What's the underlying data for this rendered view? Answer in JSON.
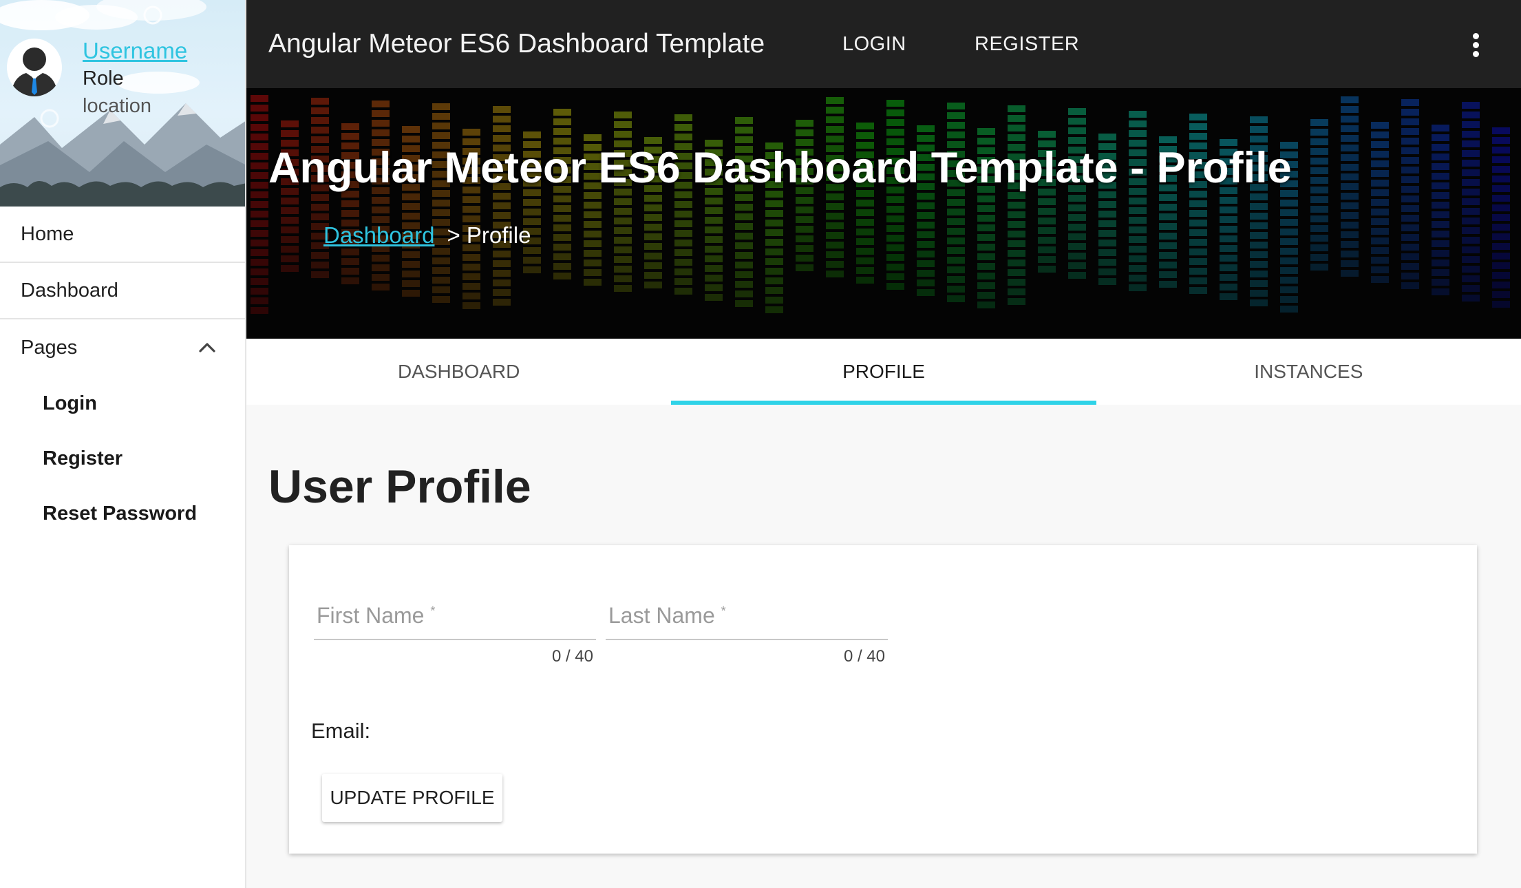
{
  "user": {
    "username": "Username",
    "role": "Role",
    "location": "location"
  },
  "sidebar": {
    "items": [
      {
        "label": "Home"
      },
      {
        "label": "Dashboard"
      },
      {
        "label": "Pages"
      }
    ],
    "pages_sub": [
      {
        "label": "Login"
      },
      {
        "label": "Register"
      },
      {
        "label": "Reset Password"
      }
    ]
  },
  "topbar": {
    "title": "Angular Meteor ES6 Dashboard Template",
    "login_label": "LOGIN",
    "register_label": "REGISTER",
    "menu_icon": "more-vert-icon"
  },
  "hero": {
    "title": "Angular Meteor ES6 Dashboard Template - Profile",
    "breadcrumb_link": "Dashboard",
    "breadcrumb_current": "> Profile"
  },
  "tabs": [
    {
      "label": "DASHBOARD",
      "active": false
    },
    {
      "label": "PROFILE",
      "active": true
    },
    {
      "label": "INSTANCES",
      "active": false
    }
  ],
  "main": {
    "heading": "User Profile",
    "form": {
      "first_name": {
        "placeholder": "First Name",
        "required_mark": "*",
        "value": "",
        "counter": "0 / 40"
      },
      "last_name": {
        "placeholder": "Last Name",
        "required_mark": "*",
        "value": "",
        "counter": "0 / 40"
      },
      "email_label": "Email:",
      "submit_label": "UPDATE PROFILE"
    }
  },
  "colors": {
    "accent": "#2fc4e0",
    "tab_indicator": "#2fd3e8",
    "topbar": "#212121"
  }
}
